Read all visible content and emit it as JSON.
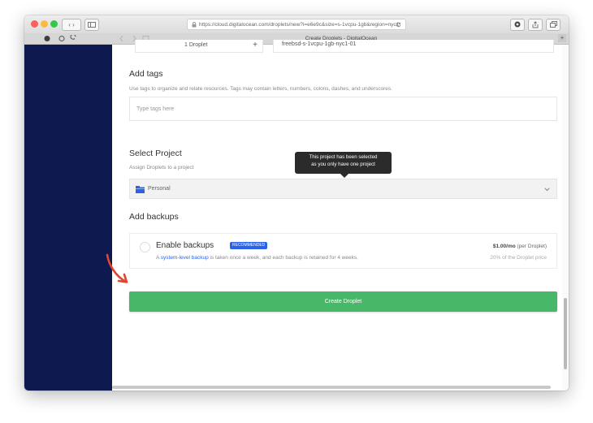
{
  "browser": {
    "url": "https://cloud.digitalocean.com/droplets/new?i=e6e9c&size=s-1vcpu-1gb&region=nyc1",
    "tab_title": "Create Droplets - DigitalOcean",
    "nav": {
      "back": "‹",
      "forward": "›"
    }
  },
  "droplet_row": {
    "quantity": "1 Droplet",
    "hostname": "freebsd-s-1vcpu-1gb-nyc1-01",
    "plus": "+"
  },
  "tags": {
    "heading": "Add tags",
    "description": "Use tags to organize and relate resources. Tags may contain letters, numbers, colons, dashes, and underscores.",
    "placeholder": "Type tags here"
  },
  "project": {
    "heading": "Select Project",
    "description": "Assign Droplets to a project",
    "tooltip_line1": "This project has been selected",
    "tooltip_line2": "as you only have one project",
    "selected": "Personal"
  },
  "backups": {
    "heading": "Add backups",
    "option_title": "Enable backups",
    "badge": "RECOMMENDED",
    "desc_prefix": "A",
    "desc_link": "system-level backup",
    "desc_suffix": "is taken once a week, and each backup is retained for 4 weeks.",
    "price": "$1.00/mo",
    "price_note": "(per Droplet)",
    "percent": "20% of the Droplet price"
  },
  "cta": {
    "label": "Create Droplet"
  },
  "colors": {
    "sidebar": "#0e1a4f",
    "cta": "#46b867",
    "badge": "#2c63e6",
    "link": "#2c63e6",
    "annotation_arrow": "#e2452f"
  }
}
